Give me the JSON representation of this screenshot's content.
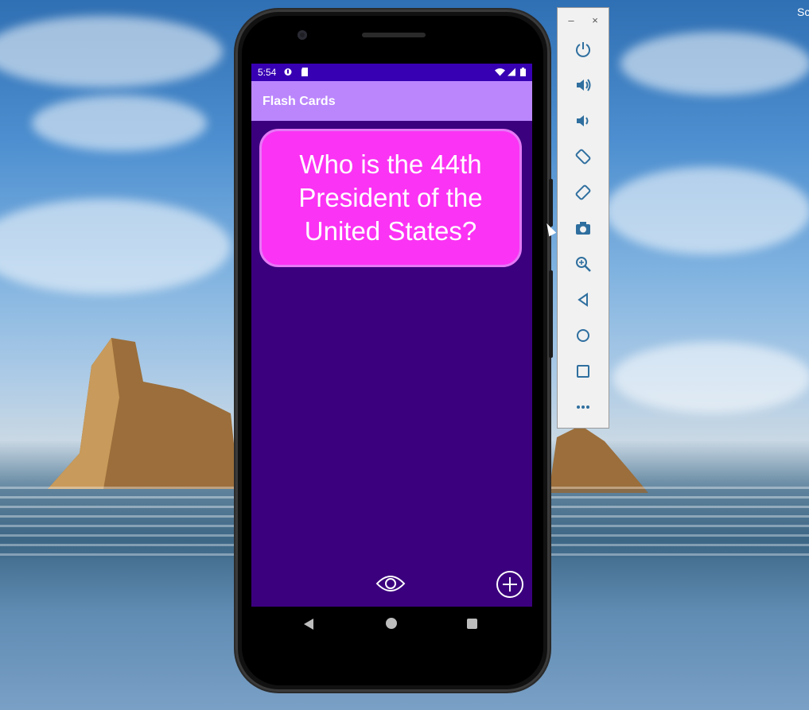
{
  "desktop": {
    "corner_text": "Sc"
  },
  "status_bar": {
    "time": "5:54"
  },
  "app": {
    "title": "Flash Cards"
  },
  "card": {
    "question": "Who is the 44th President of the United States?"
  },
  "actions": [
    {
      "name": "reveal-answer",
      "icon": "eye-icon"
    },
    {
      "name": "add-card",
      "icon": "plus-circle-icon"
    }
  ],
  "navigation": [
    {
      "name": "back",
      "icon": "triangle-back-icon"
    },
    {
      "name": "home",
      "icon": "circle-home-icon"
    },
    {
      "name": "recents",
      "icon": "square-recents-icon"
    }
  ],
  "emulator_toolbar": {
    "window_controls": {
      "minimize": "–",
      "close": "×"
    },
    "tools": [
      {
        "name": "power",
        "icon": "power-icon"
      },
      {
        "name": "volume-up",
        "icon": "volume-up-icon"
      },
      {
        "name": "volume-down",
        "icon": "volume-down-icon"
      },
      {
        "name": "rotate-left",
        "icon": "rotate-left-icon"
      },
      {
        "name": "rotate-right",
        "icon": "rotate-right-icon"
      },
      {
        "name": "screenshot",
        "icon": "camera-icon"
      },
      {
        "name": "zoom",
        "icon": "zoom-icon"
      },
      {
        "name": "back",
        "icon": "back-icon"
      },
      {
        "name": "home",
        "icon": "home-icon"
      },
      {
        "name": "overview",
        "icon": "overview-icon"
      },
      {
        "name": "more",
        "icon": "more-icon"
      }
    ]
  },
  "colors": {
    "status_bar": "#3700b3",
    "app_bar": "#bb86fc",
    "screen_background": "#3b007e",
    "card_fill": "#fb33f4",
    "card_border": "#e678f6"
  }
}
